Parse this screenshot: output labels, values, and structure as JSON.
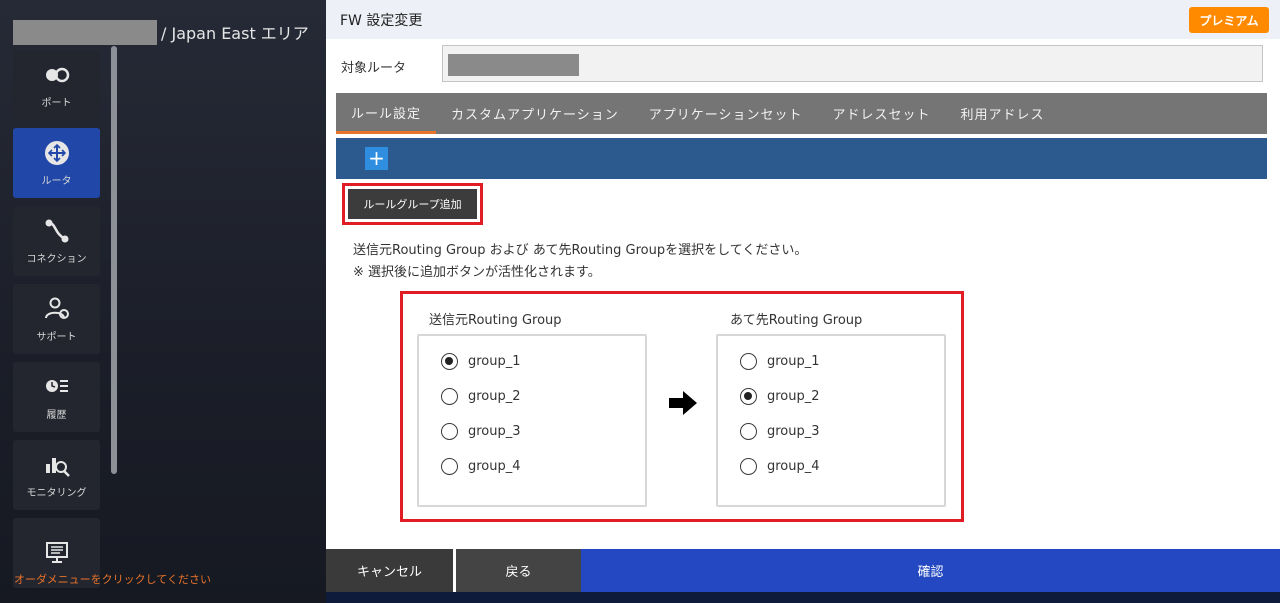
{
  "background": {
    "region_title": "/ Japan East エリア",
    "nav_items": [
      {
        "label": "ポート",
        "icon": "port-icon"
      },
      {
        "label": "ルータ",
        "icon": "router-icon",
        "active": true
      },
      {
        "label": "コネクション",
        "icon": "connection-icon"
      },
      {
        "label": "サポート",
        "icon": "support-icon"
      },
      {
        "label": "履歴",
        "icon": "history-icon"
      },
      {
        "label": "モニタリング",
        "icon": "monitoring-icon"
      },
      {
        "label": "",
        "icon": "display-icon"
      }
    ],
    "order_message": "オーダメニューをクリックしてください"
  },
  "modal": {
    "title": "FW 設定変更",
    "premium_badge": "プレミアム",
    "router_label": "対象ルータ",
    "tabs": [
      {
        "label": "ルール設定",
        "active": true
      },
      {
        "label": "カスタムアプリケーション"
      },
      {
        "label": "アプリケーションセット"
      },
      {
        "label": "アドレスセット"
      },
      {
        "label": "利用アドレス"
      }
    ],
    "add_button": "+",
    "rule_group_add_button": "ルールグループ追加",
    "instruction_line1": "送信元Routing Group および あて先Routing Groupを選択をしてください。",
    "instruction_line2": "※ 選択後に追加ボタンが活性化されます。",
    "source": {
      "title": "送信元Routing Group",
      "options": [
        "group_1",
        "group_2",
        "group_3",
        "group_4"
      ],
      "selected": "group_1"
    },
    "destination": {
      "title": "あて先Routing Group",
      "options": [
        "group_1",
        "group_2",
        "group_3",
        "group_4"
      ],
      "selected": "group_2"
    },
    "footer": {
      "cancel": "キャンセル",
      "back": "戻る",
      "confirm": "確認"
    }
  },
  "colors": {
    "accent_orange": "#ff8a00",
    "highlight_red": "#e01c24",
    "confirm_blue": "#2448c2",
    "nav_active": "#2147a8"
  }
}
